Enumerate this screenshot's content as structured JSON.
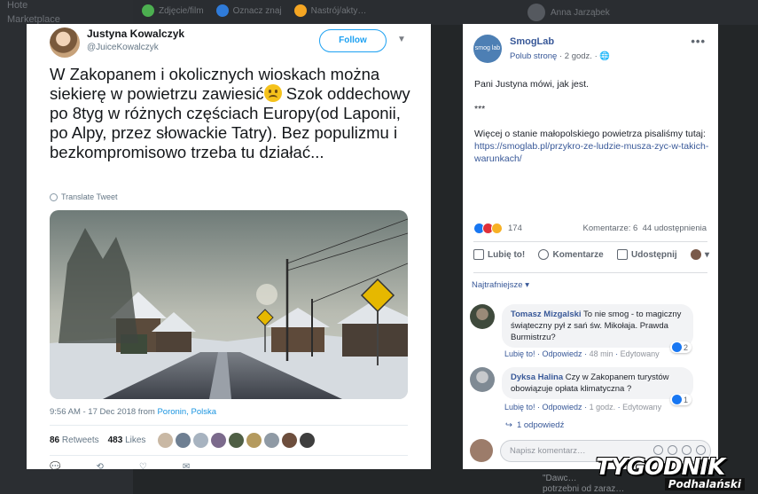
{
  "background": {
    "sidebar": [
      "Hote",
      "Marketplace"
    ],
    "chips": [
      {
        "label": "Zdjęcie/film",
        "color": "#4caf50"
      },
      {
        "label": "Oznacz znaj",
        "color": "#2f7bd9"
      },
      {
        "label": "Nastrój/akty…",
        "color": "#f5a623"
      }
    ],
    "right_name": "Anna Jarząbek",
    "bottom_text": [
      "\"Dawc…",
      "potrzebni od zaraz…"
    ]
  },
  "tweet": {
    "name": "Justyna Kowalczyk",
    "handle": "@JuiceKowalczyk",
    "follow_label": "Follow",
    "text_part1": "W Zakopanem i okolicznych wioskach można siekierę w powietrzu zawiesić",
    "text_part2": " Szok oddechowy po 8tyg w różnych częściach Europy(od Laponii, po Alpy, przez słowackie Tatry). Bez populizmu i bezkompromisowo trzeba tu działać...",
    "translate_label": "Translate Tweet",
    "time": "9:56 AM - 17 Dec 2018 from",
    "place": "Poronin, Polska",
    "retweets": "86",
    "retweets_label": "Retweets",
    "likes": "483",
    "likes_label": "Likes",
    "liker_colors": [
      "#c9b8a4",
      "#6e7f92",
      "#a7b3c0",
      "#7b6a8c",
      "#4f5f45",
      "#b49a5e",
      "#8f9aa5",
      "#6d4e3d",
      "#3e3e3e"
    ],
    "actions": [
      "💬",
      "⟲",
      "♡",
      "✉"
    ]
  },
  "fb": {
    "page_name": "SmogLab",
    "logo_text": "smog lab",
    "like_page": "Polub stronę",
    "time": " · 2 godz. ·",
    "menu": "•••",
    "line1": "Pani Justyna mówi, jak jest.",
    "line2": "***",
    "line3": "Więcej o stanie małopolskiego powietrza pisaliśmy tutaj: ",
    "link": "https://smoglab.pl/przykro-ze-ludzie-musza-zyc-w-takich-warunkach/",
    "reactions_count": "174",
    "comments_count": "Komentarze: 6",
    "shares_count": "44 udostępnienia",
    "action_like": "Lubię to!",
    "action_comment": "Komentarze",
    "action_share": "Udostępnij",
    "sort_label": "Najtrafniejsze ▾",
    "comments": [
      {
        "author": "Tomasz Mizgalski",
        "text": " To nie smog - to magiczny świąteczny pył z sań św. Mikołaja. Prawda Burmistrzu?",
        "like": "Lubię to!",
        "reply": "Odpowiedz",
        "time": "48 min",
        "edited": "Edytowany",
        "likes": "2"
      },
      {
        "author": "Dyksa Halina",
        "text": " Czy w Zakopanem turystów obowiązuje opłata klimatyczna ?",
        "like": "Lubię to!",
        "reply": "Odpowiedz",
        "time": "1 godz.",
        "edited": "Edytowany",
        "likes": "1"
      }
    ],
    "replies": "1 odpowiedź",
    "write_placeholder": "Napisz komentarz…"
  },
  "watermark": {
    "main": "TYGODNIK",
    "sub": "Podhalański"
  }
}
